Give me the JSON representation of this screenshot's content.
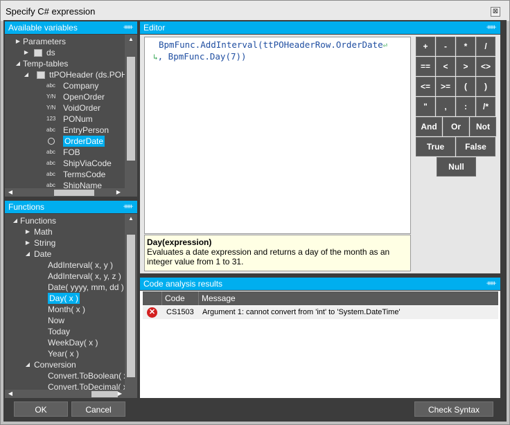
{
  "window": {
    "title": "Specify C# expression",
    "close_glyph": "⊠"
  },
  "variables": {
    "header": "Available variables",
    "pin_glyph": "ᚔ",
    "items": [
      {
        "expander": "▶",
        "icon": "",
        "label": "Parameters"
      },
      {
        "expander": "▶",
        "icon": "",
        "label": "ds"
      },
      {
        "expander": "◢",
        "icon": "",
        "label": "Temp-tables"
      },
      {
        "expander": "◢",
        "icon": "",
        "label": "ttPOHeader (ds.POH"
      },
      {
        "expander": "",
        "icon": "abc",
        "label": "Company"
      },
      {
        "expander": "",
        "icon": "Y/N",
        "label": "OpenOrder"
      },
      {
        "expander": "",
        "icon": "Y/N",
        "label": "VoidOrder"
      },
      {
        "expander": "",
        "icon": "123",
        "label": "PONum"
      },
      {
        "expander": "",
        "icon": "abc",
        "label": "EntryPerson"
      },
      {
        "expander": "",
        "icon": "",
        "label": "OrderDate"
      },
      {
        "expander": "",
        "icon": "abc",
        "label": "FOB"
      },
      {
        "expander": "",
        "icon": "abc",
        "label": "ShipViaCode"
      },
      {
        "expander": "",
        "icon": "abc",
        "label": "TermsCode"
      },
      {
        "expander": "",
        "icon": "abc",
        "label": "ShipName"
      }
    ]
  },
  "functions": {
    "header": "Functions",
    "items": [
      {
        "expander": "◢",
        "label": "Functions"
      },
      {
        "expander": "▶",
        "label": "Math"
      },
      {
        "expander": "▶",
        "label": "String"
      },
      {
        "expander": "◢",
        "label": "Date"
      },
      {
        "expander": "",
        "label": "AddInterval( x, y )"
      },
      {
        "expander": "",
        "label": "AddInterval( x, y, z )"
      },
      {
        "expander": "",
        "label": "Date( yyyy, mm, dd )"
      },
      {
        "expander": "",
        "label": "Day( x )"
      },
      {
        "expander": "",
        "label": "Month( x )"
      },
      {
        "expander": "",
        "label": "Now"
      },
      {
        "expander": "",
        "label": "Today"
      },
      {
        "expander": "",
        "label": "WeekDay( x )"
      },
      {
        "expander": "",
        "label": "Year( x )"
      },
      {
        "expander": "◢",
        "label": "Conversion"
      },
      {
        "expander": "",
        "label": "Convert.ToBoolean( x"
      },
      {
        "expander": "",
        "label": "Convert.ToDecimal( x"
      }
    ]
  },
  "editor": {
    "header": "Editor",
    "line1": "BpmFunc.AddInterval(ttPOHeaderRow.OrderDate",
    "line2": ", BpmFunc.Day(7))",
    "wrap_glyph_end": "⏎",
    "wrap_glyph_start": "↳"
  },
  "help": {
    "title": "Day(expression)",
    "description": "Evaluates a date expression and returns a day of the month as an integer value from 1 to 31."
  },
  "keypad": {
    "row1": [
      "+",
      "-",
      "*",
      "/"
    ],
    "row2": [
      "==",
      "<",
      ">",
      "<>"
    ],
    "row3": [
      "<=",
      ">=",
      "(",
      ")"
    ],
    "row4": [
      "\"",
      ",",
      ":",
      "/*"
    ],
    "row5": [
      "And",
      "Or",
      "Not"
    ],
    "row6": [
      "True",
      "False"
    ],
    "row7": [
      "Null"
    ]
  },
  "results": {
    "header": "Code analysis results",
    "columns": [
      "",
      "Code",
      "Message"
    ],
    "rows": [
      {
        "icon": "error-icon",
        "code": "CS1503",
        "message": "Argument 1: cannot convert from 'int' to 'System.DateTime'"
      }
    ]
  },
  "buttons": {
    "ok": "OK",
    "cancel": "Cancel",
    "check_syntax": "Check Syntax"
  },
  "colors": {
    "accent": "#00aeef",
    "error": "#d32020",
    "panel_bg": "#4d4d4d"
  }
}
